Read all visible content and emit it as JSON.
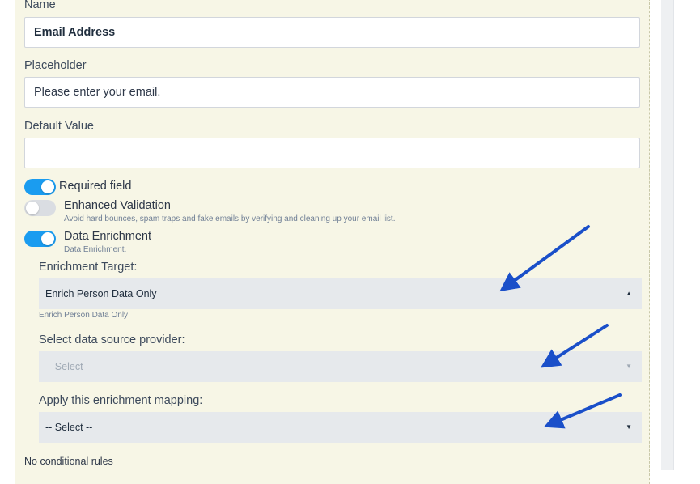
{
  "fields": {
    "name": {
      "label": "Name",
      "value": "Email Address"
    },
    "placeholder": {
      "label": "Placeholder",
      "value": "Please enter your email."
    },
    "default_value": {
      "label": "Default Value",
      "value": ""
    }
  },
  "toggles": {
    "required": {
      "label": "Required field",
      "on": true
    },
    "enhanced_validation": {
      "label": "Enhanced Validation",
      "help": "Avoid hard bounces, spam traps and fake emails by verifying and cleaning up your email list.",
      "on": false
    },
    "data_enrichment": {
      "label": "Data Enrichment",
      "help": "Data Enrichment.",
      "on": true
    }
  },
  "enrichment": {
    "target_label": "Enrichment Target:",
    "target_value": "Enrich Person Data Only",
    "target_help": "Enrich Person Data Only",
    "provider_label": "Select data source provider:",
    "provider_value": "-- Select --",
    "mapping_label": "Apply this enrichment mapping:",
    "mapping_value": "-- Select --"
  },
  "conditional": "No conditional rules",
  "icons": {
    "caret_up": "▲",
    "caret_down": "▼",
    "arrow": "annotation-arrow-icon"
  },
  "colors": {
    "toggle_on": "#1a9cf0",
    "toggle_off": "#dadde2",
    "panel_bg": "#f7f6e6",
    "annotation_arrow": "#1a4fc9"
  }
}
